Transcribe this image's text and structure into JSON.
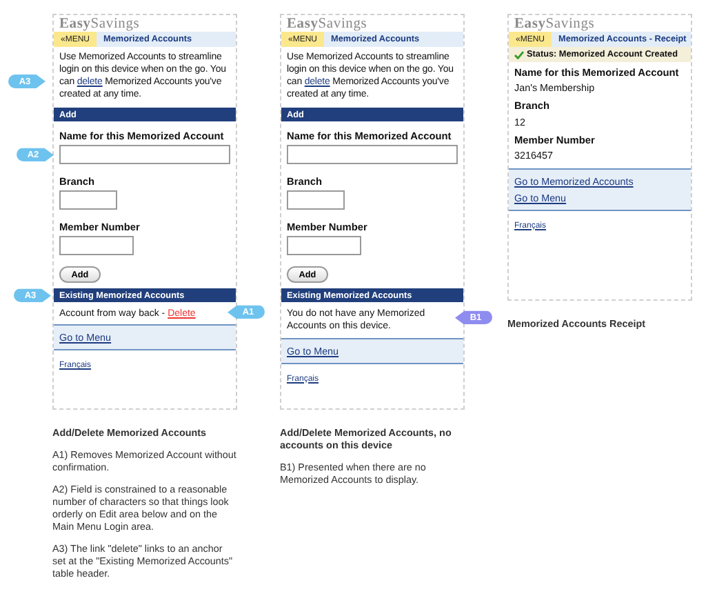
{
  "screens": [
    {
      "kind": "form",
      "logo": "**Easy**Savings",
      "menu_button": "«MENU",
      "title": "Memorized Accounts",
      "intro": {
        "text_before": "Use Memorized Accounts to streamline login on this device when on the go. You can ",
        "link": "delete",
        "text_after": " Memorized Accounts you've created at any time.",
        "callout": {
          "label": "A3",
          "color": "#6ec3ee"
        }
      },
      "add_header": "Add",
      "fields": [
        {
          "label": "Name for this Memorized Account",
          "callout": {
            "label": "A2",
            "color": "#6ec3ee"
          }
        },
        {
          "label": "Branch"
        },
        {
          "label": "Member Number"
        }
      ],
      "add_button": "Add",
      "existing_header": {
        "text": "Existing Memorized Accounts",
        "callout": {
          "label": "A3",
          "color": "#6ec3ee"
        }
      },
      "accounts": [
        {
          "name": "Account from way back - ",
          "delete_link": "Delete",
          "callout": {
            "label": "A1",
            "color": "#6ec3ee"
          }
        }
      ],
      "links": [
        "Go to Menu"
      ],
      "language_link": "Français",
      "caption": {
        "title": "Add/Delete Memorized Accounts",
        "notes": [
          "A1) Removes Memorized Account without confirmation.",
          "A2) Field is constrained to a reasonable number of characters so that things look orderly on Edit area below and on the Main Menu Login area.",
          "A3) The link \"delete\" links to an anchor set at the \"Existing Memorized Accounts\" table header."
        ]
      }
    },
    {
      "kind": "form",
      "logo": "**Easy**Savings",
      "menu_button": "«MENU",
      "title": "Memorized Accounts",
      "intro": {
        "text_before": "Use Memorized Accounts to streamline login on this device when on the go. You can ",
        "link": "delete",
        "text_after": " Memorized Accounts you've created at any time."
      },
      "add_header": "Add",
      "fields": [
        {
          "label": "Name for this Memorized Account"
        },
        {
          "label": "Branch"
        },
        {
          "label": "Member Number"
        }
      ],
      "add_button": "Add",
      "existing_header": {
        "text": "Existing Memorized Accounts"
      },
      "empty_message": {
        "text": "You do not have any Memorized Accounts on this device.",
        "callout": {
          "label": "B1",
          "color": "#8f8cf0"
        }
      },
      "links": [
        "Go to Menu"
      ],
      "language_link": "Français",
      "caption": {
        "title": "Add/Delete Memorized Accounts, no accounts on this device",
        "notes": [
          "B1) Presented when there are no Memorized Accounts to display."
        ]
      }
    },
    {
      "kind": "receipt",
      "logo": "**Easy**Savings",
      "menu_button": "«MENU",
      "title": "Memorized Accounts - Receipt",
      "status": "Status: Memorized Account Created",
      "details": [
        {
          "label": "Name for this Memorized Account",
          "value": "Jan's Membership"
        },
        {
          "label": "Branch",
          "value": "12"
        },
        {
          "label": "Member Number",
          "value": "3216457"
        }
      ],
      "links": [
        "Go to Memorized Accounts",
        "Go to Menu"
      ],
      "language_link": "Français",
      "caption": {
        "title": "Memorized Accounts Receipt"
      }
    }
  ]
}
